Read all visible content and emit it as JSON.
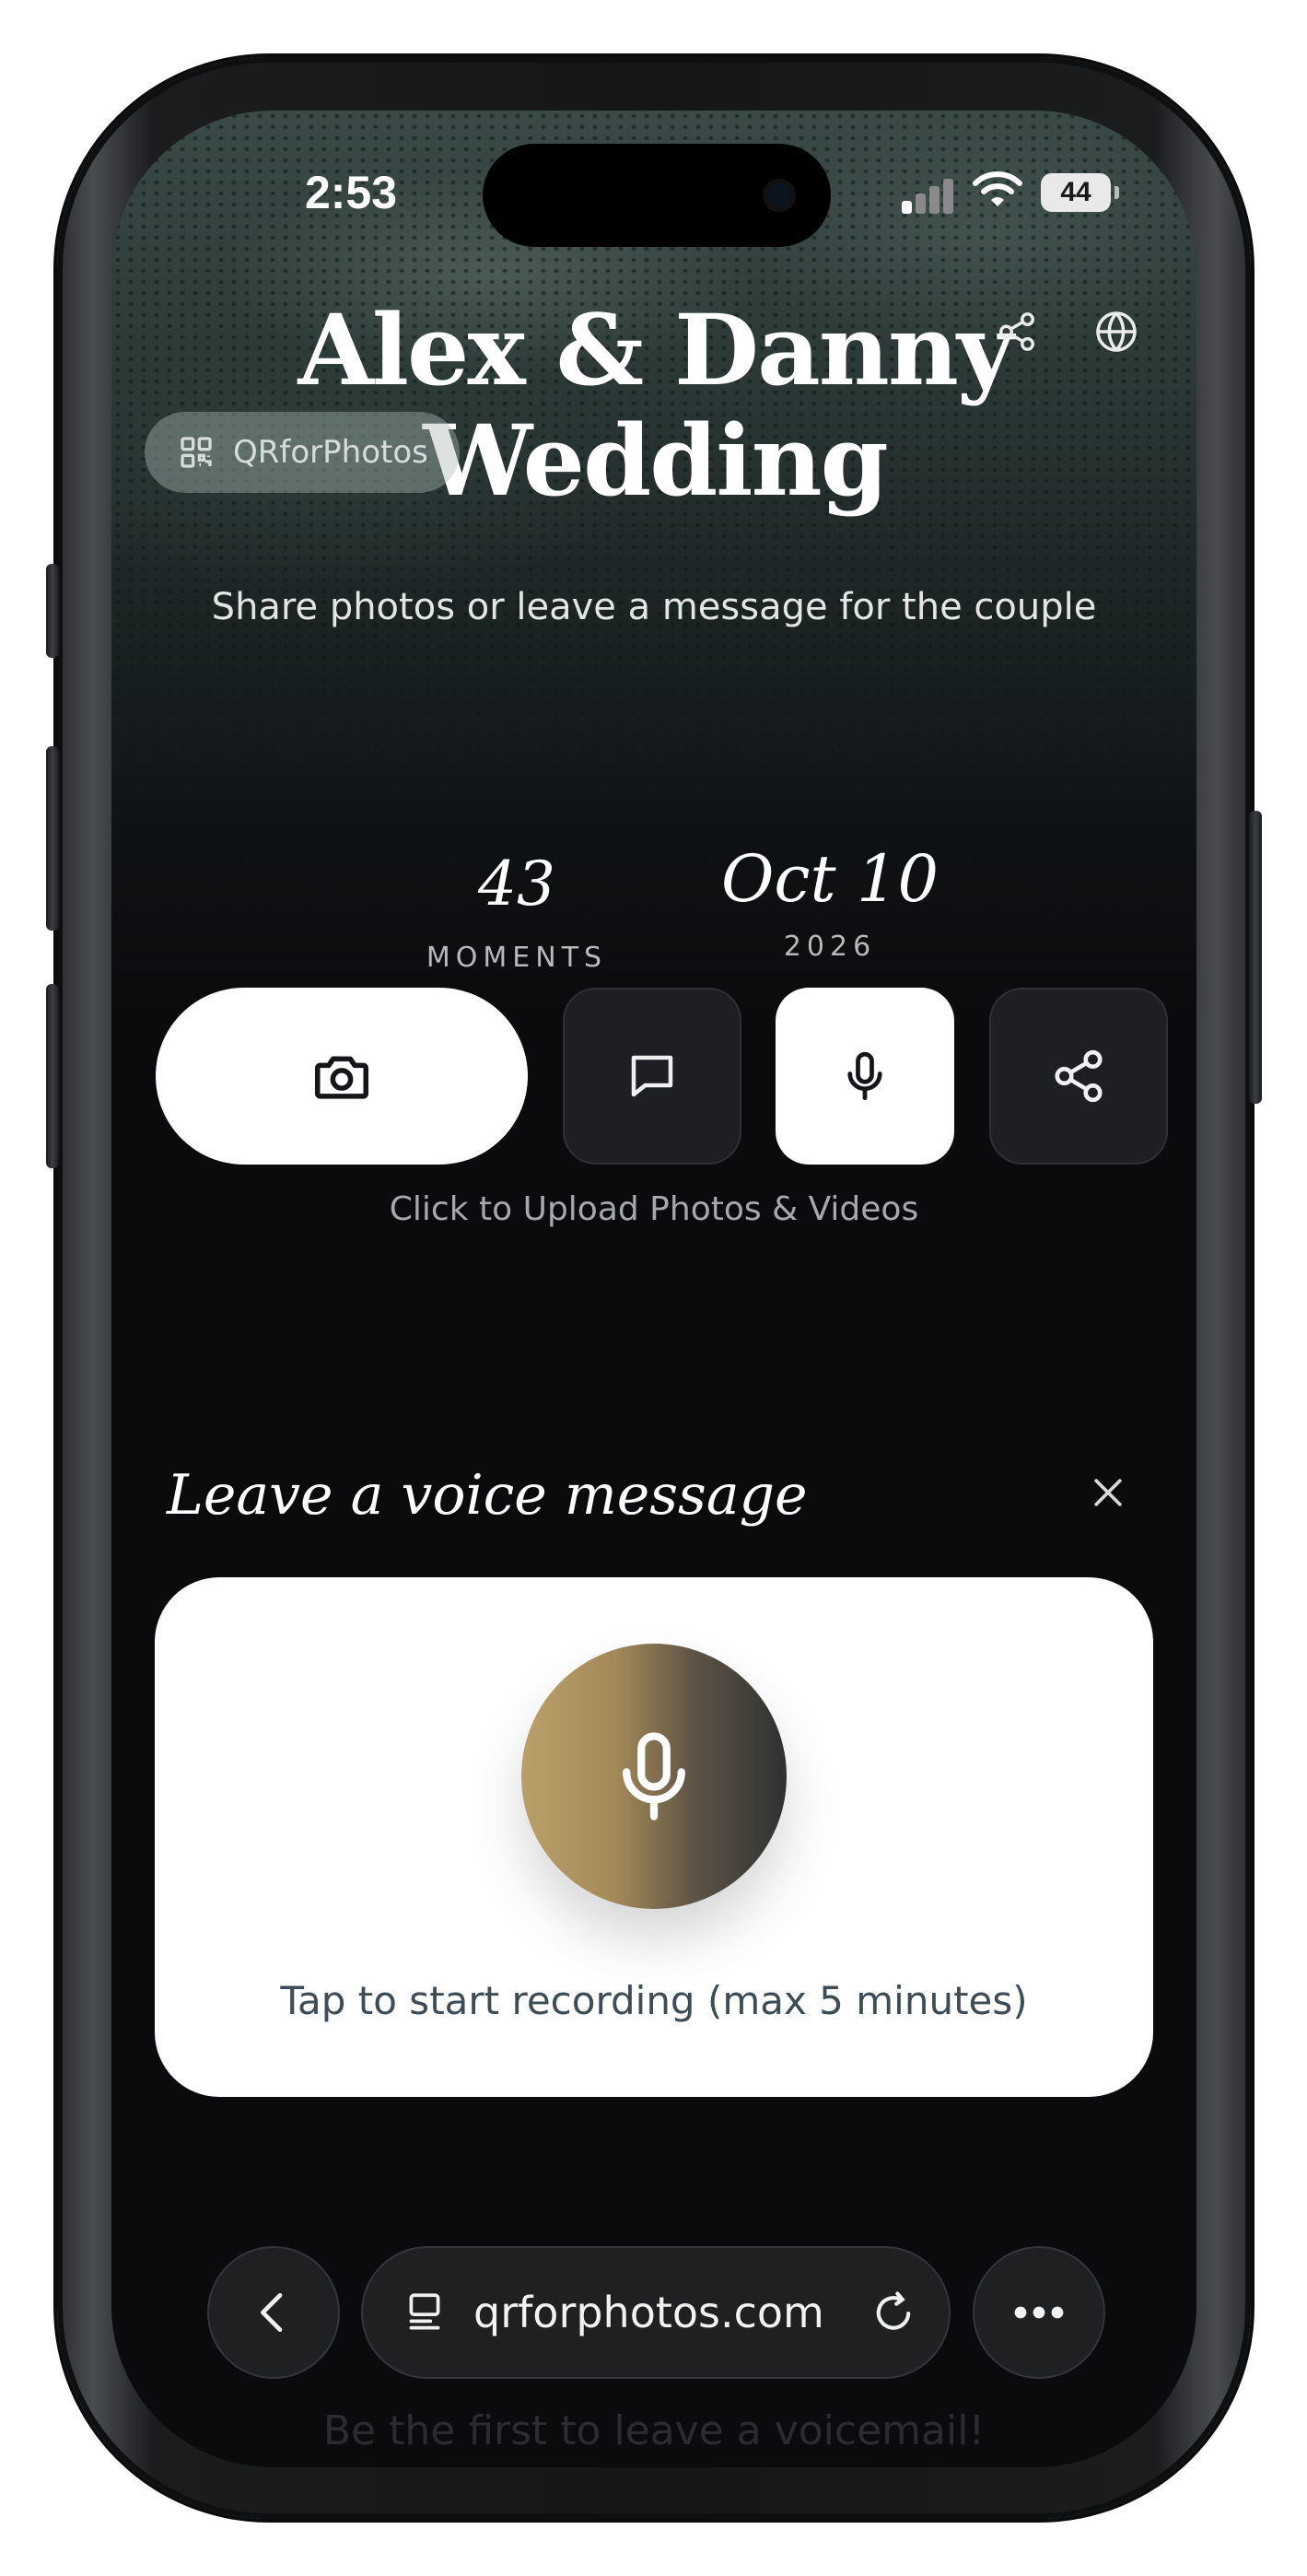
{
  "status_bar": {
    "time": "2:53",
    "battery": "44"
  },
  "header": {
    "title_line1": "Alex & Danny",
    "title_line2": "Wedding",
    "brand_label": "QRforPhotos",
    "subtitle": "Share photos or leave a message for the couple"
  },
  "stats": [
    {
      "value": "43",
      "label": "MOMENTS"
    },
    {
      "value": "Oct 10",
      "label": "2026"
    }
  ],
  "actions": {
    "upload_hint": "Click to Upload Photos & Videos",
    "buttons": [
      "camera-icon",
      "message-icon",
      "microphone-icon",
      "share-icon"
    ]
  },
  "voice": {
    "title": "Leave a voice message",
    "record_hint": "Tap to start recording (max 5 minutes)",
    "empty_state": "Be the first to leave a voicemail!"
  },
  "browser": {
    "url": "qrforphotos.com"
  },
  "colors": {
    "background": "#0b0b0e",
    "card": "#ffffff",
    "mic_gradient_start": "#b9a06a",
    "mic_gradient_end": "#2f3132",
    "dark_button": "#1e1f22"
  }
}
